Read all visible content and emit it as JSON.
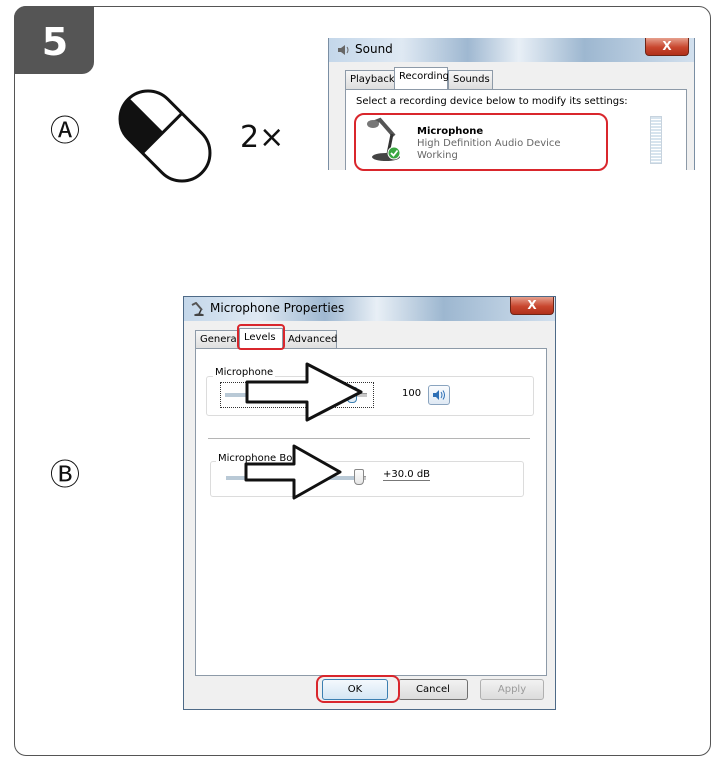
{
  "step": {
    "number": "5"
  },
  "labels": {
    "a": "Ⓐ",
    "b": "Ⓑ",
    "double_click": "2×"
  },
  "sound_dialog": {
    "title": "Sound",
    "close": "X",
    "tabs": [
      "Playback",
      "Recording",
      "Sounds"
    ],
    "instruction": "Select a recording device below to modify its settings:",
    "device": {
      "name": "Microphone",
      "driver": "High Definition Audio Device",
      "status": "Working"
    }
  },
  "mic_dialog": {
    "title": "Microphone Properties",
    "close": "X",
    "tabs": [
      "General",
      "Levels",
      "Advanced"
    ],
    "mic_group": {
      "label": "Microphone",
      "value": "100",
      "level": 1.0
    },
    "boost_group": {
      "label": "Microphone Boost",
      "value": "+30.0 dB",
      "level": 1.0
    },
    "buttons": {
      "ok": "OK",
      "cancel": "Cancel",
      "apply": "Apply"
    }
  },
  "colors": {
    "badge": "#555555",
    "highlight": "#d9262c",
    "win_bg": "#f0f0f0"
  }
}
